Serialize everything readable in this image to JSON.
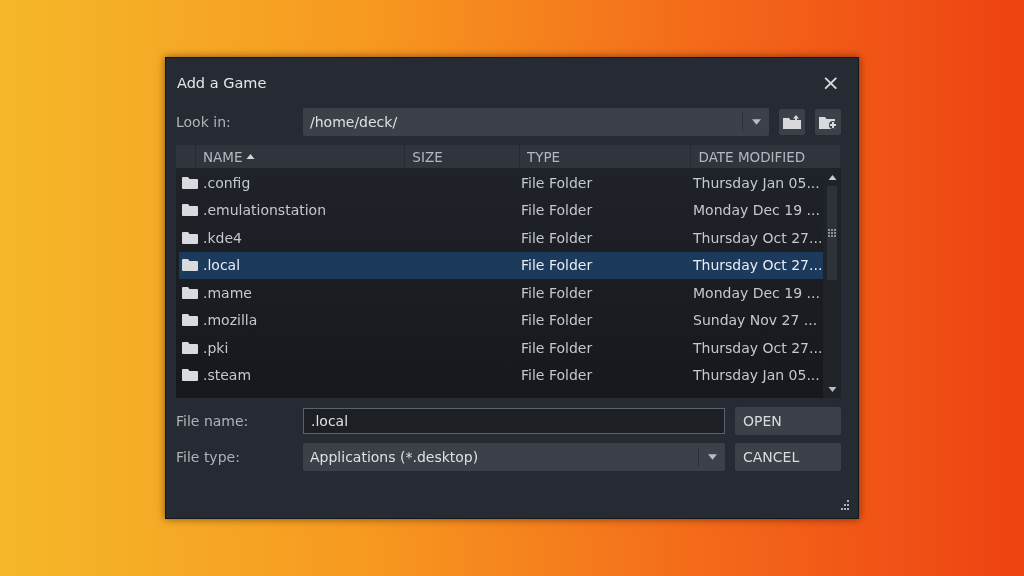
{
  "window": {
    "title": "Add a Game",
    "close": "×"
  },
  "look_in": {
    "label": "Look in:",
    "value": "/home/deck/"
  },
  "table": {
    "columns": [
      {
        "label": "NAME",
        "sorted": true
      },
      {
        "label": "SIZE",
        "sorted": false
      },
      {
        "label": "TYPE",
        "sorted": false
      },
      {
        "label": "DATE MODIFIED",
        "sorted": false
      }
    ],
    "rows": [
      {
        "name": ".config",
        "type": "File Folder",
        "date": "Thursday Jan 05...",
        "selected": false
      },
      {
        "name": ".emulationstation",
        "type": "File Folder",
        "date": "Monday Dec 19 ...",
        "selected": false
      },
      {
        "name": ".kde4",
        "type": "File Folder",
        "date": "Thursday Oct 27...",
        "selected": false
      },
      {
        "name": ".local",
        "type": "File Folder",
        "date": "Thursday Oct 27...",
        "selected": true
      },
      {
        "name": ".mame",
        "type": "File Folder",
        "date": "Monday Dec 19 ...",
        "selected": false
      },
      {
        "name": ".mozilla",
        "type": "File Folder",
        "date": "Sunday Nov 27 ...",
        "selected": false
      },
      {
        "name": ".pki",
        "type": "File Folder",
        "date": "Thursday Oct 27...",
        "selected": false
      },
      {
        "name": ".steam",
        "type": "File Folder",
        "date": "Thursday Jan 05...",
        "selected": false
      }
    ]
  },
  "file_name": {
    "label": "File name:",
    "value": ".local"
  },
  "file_type": {
    "label": "File type:",
    "value": "Applications (*.desktop)"
  },
  "buttons": [
    "OPEN",
    "CANCEL"
  ]
}
